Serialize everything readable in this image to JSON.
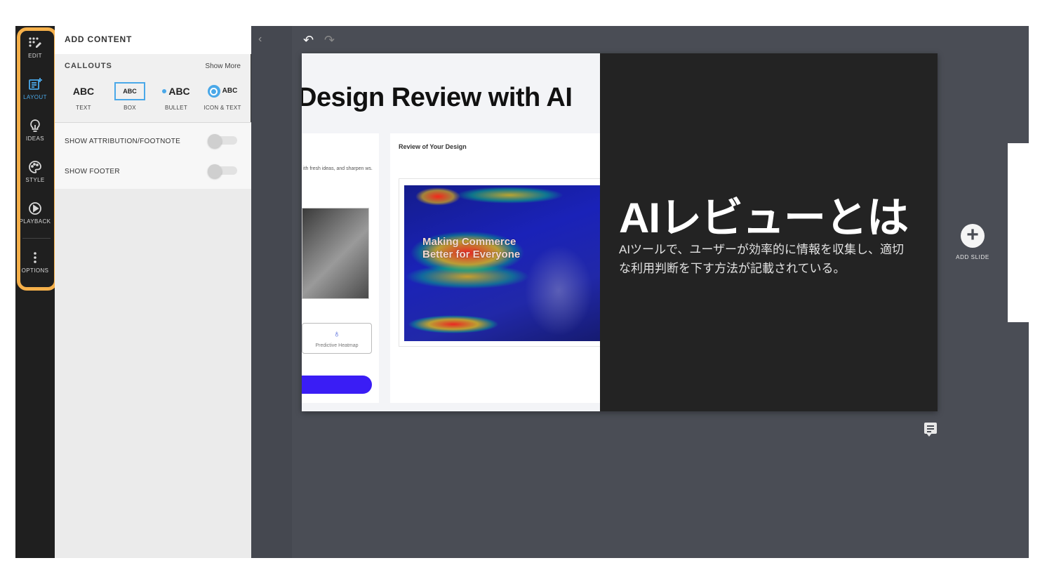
{
  "rail": {
    "items": [
      {
        "label": "EDIT",
        "icon": "edit-icon"
      },
      {
        "label": "LAYOUT",
        "icon": "layout-icon",
        "active": true
      },
      {
        "label": "IDEAS",
        "icon": "lightbulb-icon"
      },
      {
        "label": "STYLE",
        "icon": "palette-icon"
      },
      {
        "label": "PLAYBACK",
        "icon": "play-icon"
      },
      {
        "label": "OPTIONS",
        "icon": "more-vertical-icon"
      }
    ],
    "highlight_color": "#f5b04a",
    "active_color": "#4aa8e8"
  },
  "panel": {
    "title": "ADD CONTENT",
    "section_title": "CALLOUTS",
    "show_more": "Show More",
    "callouts": [
      {
        "sample": "ABC",
        "label": "TEXT"
      },
      {
        "sample": "ABC",
        "label": "BOX"
      },
      {
        "sample": "ABC",
        "label": "BULLET"
      },
      {
        "sample": "ABC",
        "label": "ICON & TEXT"
      }
    ],
    "options": [
      {
        "label": "SHOW ATTRIBUTION/FOOTNOTE",
        "enabled": false
      },
      {
        "label": "SHOW FOOTER",
        "enabled": false
      }
    ]
  },
  "toolbar": {
    "collapse": "‹",
    "undo": "↶",
    "redo": "↷"
  },
  "slide": {
    "screenshot": {
      "title": "Design Review with AI",
      "left_text": "ith fresh ideas, and sharpen ws.",
      "heatmap_button": "Predictive Heatmap",
      "heatmap_glyph": "♁",
      "card_title": "Review of Your Design",
      "heatmap_headline": "Making Commerce Better for Everyone"
    },
    "title": "AIレビューとは",
    "body": "AIツールで、ユーザーが効率的に情報を収集し、適切な利用判断を下す方法が記載されている。"
  },
  "add_slide": {
    "plus": "+",
    "label": "ADD SLIDE"
  }
}
